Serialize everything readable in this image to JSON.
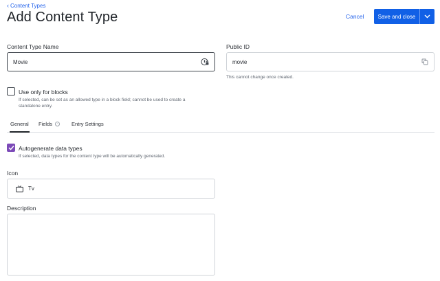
{
  "header": {
    "back_label": "Content Types",
    "title": "Add Content Type",
    "cancel_label": "Cancel",
    "save_label": "Save and close"
  },
  "form": {
    "name_label": "Content Type Name",
    "name_value": "Movie",
    "public_id_label": "Public ID",
    "public_id_value": "movie",
    "public_id_hint": "This cannot change once created.",
    "blocks_label": "Use only for blocks",
    "blocks_checked": false,
    "blocks_hint_line1": "If selected, can be set as an allowed type in a block field; cannot be used to create a",
    "blocks_hint_line2": "standalone entry."
  },
  "tabs": [
    {
      "label": "General",
      "active": true
    },
    {
      "label": "Fields",
      "active": false
    },
    {
      "label": "Entry Settings",
      "active": false
    }
  ],
  "general": {
    "autogen_label": "Autogenerate data types",
    "autogen_checked": true,
    "autogen_hint": "If selected, data types for the content type will be automatically generated.",
    "icon_label": "Icon",
    "icon_value": "Tv",
    "icon_name": "tv-icon",
    "description_label": "Description",
    "description_value": ""
  },
  "colors": {
    "accent": "#1160e6",
    "link": "#2463eb",
    "checkbox_checked": "#7c4ab8"
  }
}
